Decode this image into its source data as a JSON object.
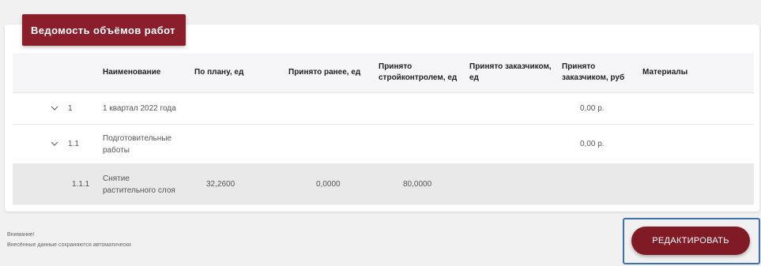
{
  "colors": {
    "accent": "#8a1f2b",
    "button": "#801a24",
    "focus_frame": "#3d70b2",
    "page_bg": "#f1f1f2"
  },
  "card": {
    "title": "Ведомость объёмов работ"
  },
  "table": {
    "headers": [
      "",
      "Наименование",
      "По плану, ед",
      "Принято ранее, ед",
      "Принято стройконтролем, ед",
      "Принято заказчиком, ед",
      "Принято заказчиком, руб",
      "Материалы"
    ],
    "rows": [
      {
        "num": "1",
        "expandable": true,
        "name": "1 квартал 2022 года",
        "plan": "",
        "prev": "",
        "stroy": "",
        "cust": "",
        "rub": "0,00 р.",
        "mat": ""
      },
      {
        "num": "1.1",
        "expandable": true,
        "name": "Подготовительные работы",
        "plan": "",
        "prev": "",
        "stroy": "",
        "cust": "",
        "rub": "0,00 р.",
        "mat": ""
      },
      {
        "num": "1.1.1",
        "expandable": false,
        "name": "Снятие растительного слоя",
        "plan": "32,2600",
        "prev": "0,0000",
        "stroy": "80,0000",
        "cust": "",
        "rub": "",
        "mat": ""
      }
    ]
  },
  "footer": {
    "note_line1": "Внимание!",
    "note_line2": "Внесённые данные сохраняются автоматически",
    "edit_button": "РЕДАКТИРОВАТЬ"
  },
  "icons": {
    "expand": "chevron-down-icon"
  }
}
